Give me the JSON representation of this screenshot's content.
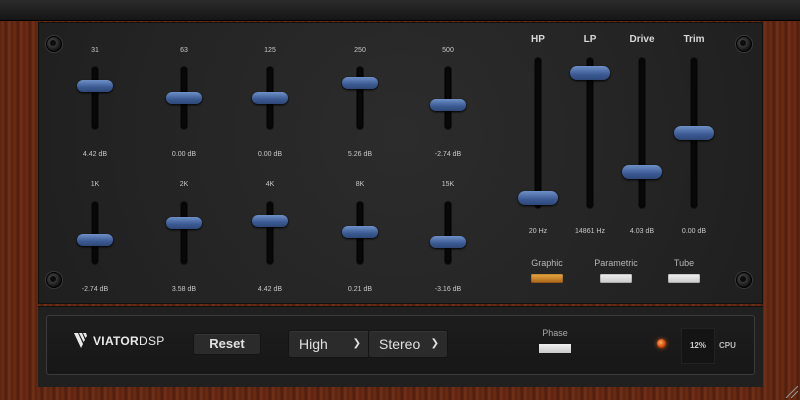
{
  "eq": {
    "row1": [
      {
        "band": "31",
        "value": "4.42 dB",
        "level": 0.7
      },
      {
        "band": "63",
        "value": "0.00 dB",
        "level": 0.5
      },
      {
        "band": "125",
        "value": "0.00 dB",
        "level": 0.5
      },
      {
        "band": "250",
        "value": "5.26 dB",
        "level": 0.74
      },
      {
        "band": "500",
        "value": "-2.74 dB",
        "level": 0.38
      }
    ],
    "row2": [
      {
        "band": "1K",
        "value": "-2.74 dB",
        "level": 0.38
      },
      {
        "band": "2K",
        "value": "3.58 dB",
        "level": 0.66
      },
      {
        "band": "4K",
        "value": "4.42 dB",
        "level": 0.7
      },
      {
        "band": "8K",
        "value": "0.21 dB",
        "level": 0.51
      },
      {
        "band": "15K",
        "value": "-3.16 dB",
        "level": 0.36
      }
    ]
  },
  "faders": [
    {
      "label": "HP",
      "value": "20 Hz",
      "level": 0.0
    },
    {
      "label": "LP",
      "value": "14861 Hz",
      "level": 0.96
    },
    {
      "label": "Drive",
      "value": "4.03 dB",
      "level": 0.2
    },
    {
      "label": "Trim",
      "value": "0.00 dB",
      "level": 0.5
    }
  ],
  "modes": [
    {
      "label": "Graphic",
      "active": true
    },
    {
      "label": "Parametric",
      "active": false
    },
    {
      "label": "Tube",
      "active": false
    }
  ],
  "bottom": {
    "logo_main": "VIATOR",
    "logo_dsp": "DSP",
    "reset_label": "Reset",
    "quality": "High",
    "channel": "Stereo",
    "phase_label": "Phase",
    "cpu_value": "12%",
    "cpu_label": "CPU"
  },
  "icons": {
    "chevron": "chevron-down-icon",
    "logo": "viator-logo-icon"
  }
}
